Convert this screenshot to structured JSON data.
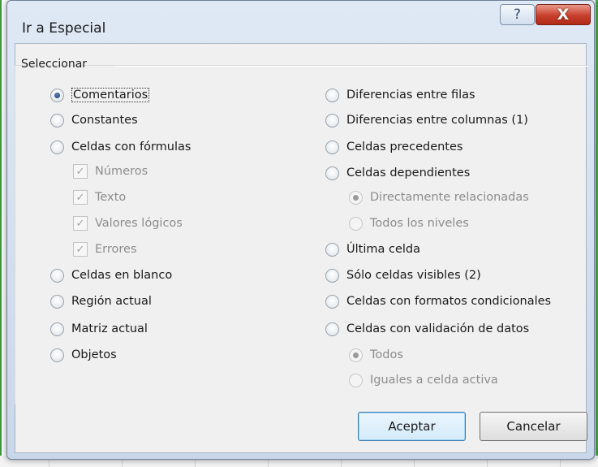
{
  "dialog": {
    "title": "Ir a Especial",
    "help_label": "?",
    "close_label": "X",
    "group_label": "Seleccionar"
  },
  "left_options": [
    {
      "label": "Comentarios",
      "checked": true
    },
    {
      "label": "Constantes",
      "checked": false
    },
    {
      "label": "Celdas con fórmulas",
      "checked": false
    }
  ],
  "formula_types": [
    {
      "label": "Números",
      "checked": true
    },
    {
      "label": "Texto",
      "checked": true
    },
    {
      "label": "Valores lógicos",
      "checked": true
    },
    {
      "label": "Errores",
      "checked": true
    }
  ],
  "left_options_2": [
    {
      "label": "Celdas en blanco"
    },
    {
      "label": "Región actual"
    },
    {
      "label": "Matriz actual"
    },
    {
      "label": "Objetos"
    }
  ],
  "right_options": [
    {
      "label": "Diferencias entre filas"
    },
    {
      "label": "Diferencias entre columnas (1)"
    },
    {
      "label": "Celdas precedentes"
    },
    {
      "label": "Celdas dependientes"
    }
  ],
  "dependents_sub": [
    {
      "label": "Directamente relacionadas",
      "checked": true
    },
    {
      "label": "Todos los niveles",
      "checked": false
    }
  ],
  "right_options_2": [
    {
      "label": "Última celda"
    },
    {
      "label": "Sólo celdas visibles (2)"
    },
    {
      "label": "Celdas con formatos condicionales"
    },
    {
      "label": "Celdas con validación de datos"
    }
  ],
  "validation_sub": [
    {
      "label": "Todos",
      "checked": true
    },
    {
      "label": "Iguales a celda activa",
      "checked": false
    }
  ],
  "buttons": {
    "ok_label": "Aceptar",
    "cancel_label": "Cancelar"
  }
}
